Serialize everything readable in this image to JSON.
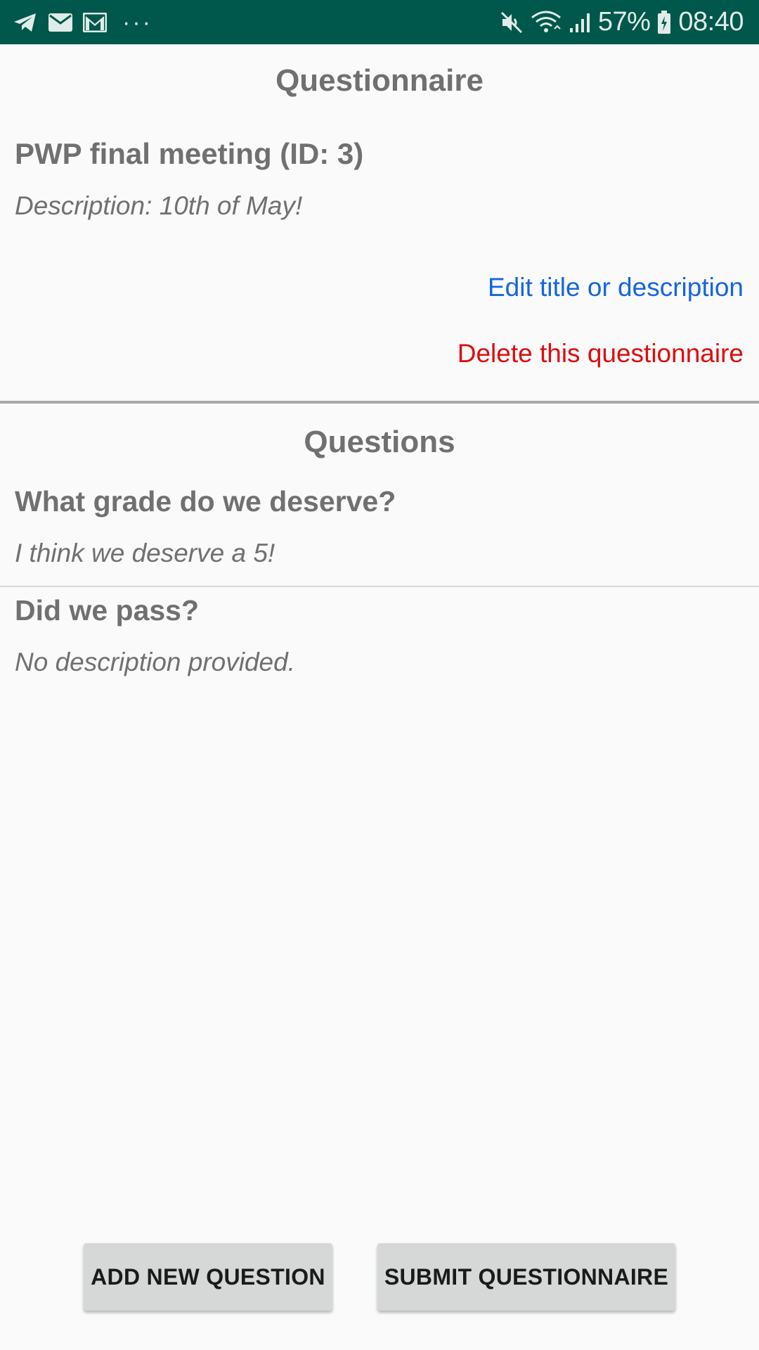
{
  "status_bar": {
    "battery_percent": "57%",
    "time": "08:40",
    "more_indicator": "···",
    "icons": [
      "telegram-icon",
      "email-icon",
      "gmail-icon",
      "mute-icon",
      "wifi-icon",
      "signal-icon",
      "battery-icon"
    ],
    "background_color": "#00574b"
  },
  "screen": {
    "title": "Questionnaire"
  },
  "questionnaire": {
    "title": "PWP final meeting (ID: 3)",
    "description": "Description: 10th of May!",
    "edit_link": "Edit title or description",
    "delete_link": "Delete this questionnaire",
    "edit_color": "#1565e0",
    "delete_color": "#e00b0b"
  },
  "questions_section": {
    "title": "Questions",
    "items": [
      {
        "title": "What grade do we deserve?",
        "description": "I think we deserve a 5!"
      },
      {
        "title": "Did we pass?",
        "description": "No description provided."
      }
    ]
  },
  "buttons": {
    "add_question": "ADD NEW QUESTION",
    "submit": "SUBMIT QUESTIONNAIRE"
  }
}
